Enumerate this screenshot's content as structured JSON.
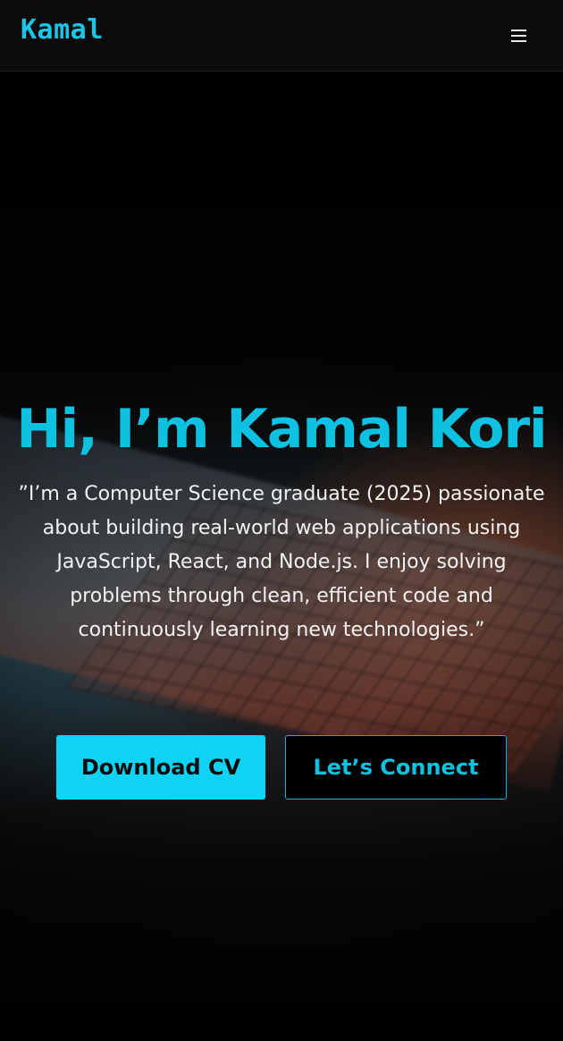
{
  "nav": {
    "brand": "Kamal",
    "menu_icon": "hamburger-menu-icon"
  },
  "hero": {
    "title": "Hi, I’m Kamal Kori",
    "description": "”I’m a Computer Science graduate (2025) passionate about building real-world web applications using JavaScript, React, and Node.js. I enjoy solving problems through clean, efficient code and continuously learning new technologies.”",
    "download_cv_label": "Download CV",
    "connect_label": "Let’s Connect"
  },
  "colors": {
    "accent": "#0fc1e0",
    "button_primary": "#0fd3f5",
    "navbar_bg": "#0b0b0b",
    "page_bg": "#000000"
  }
}
